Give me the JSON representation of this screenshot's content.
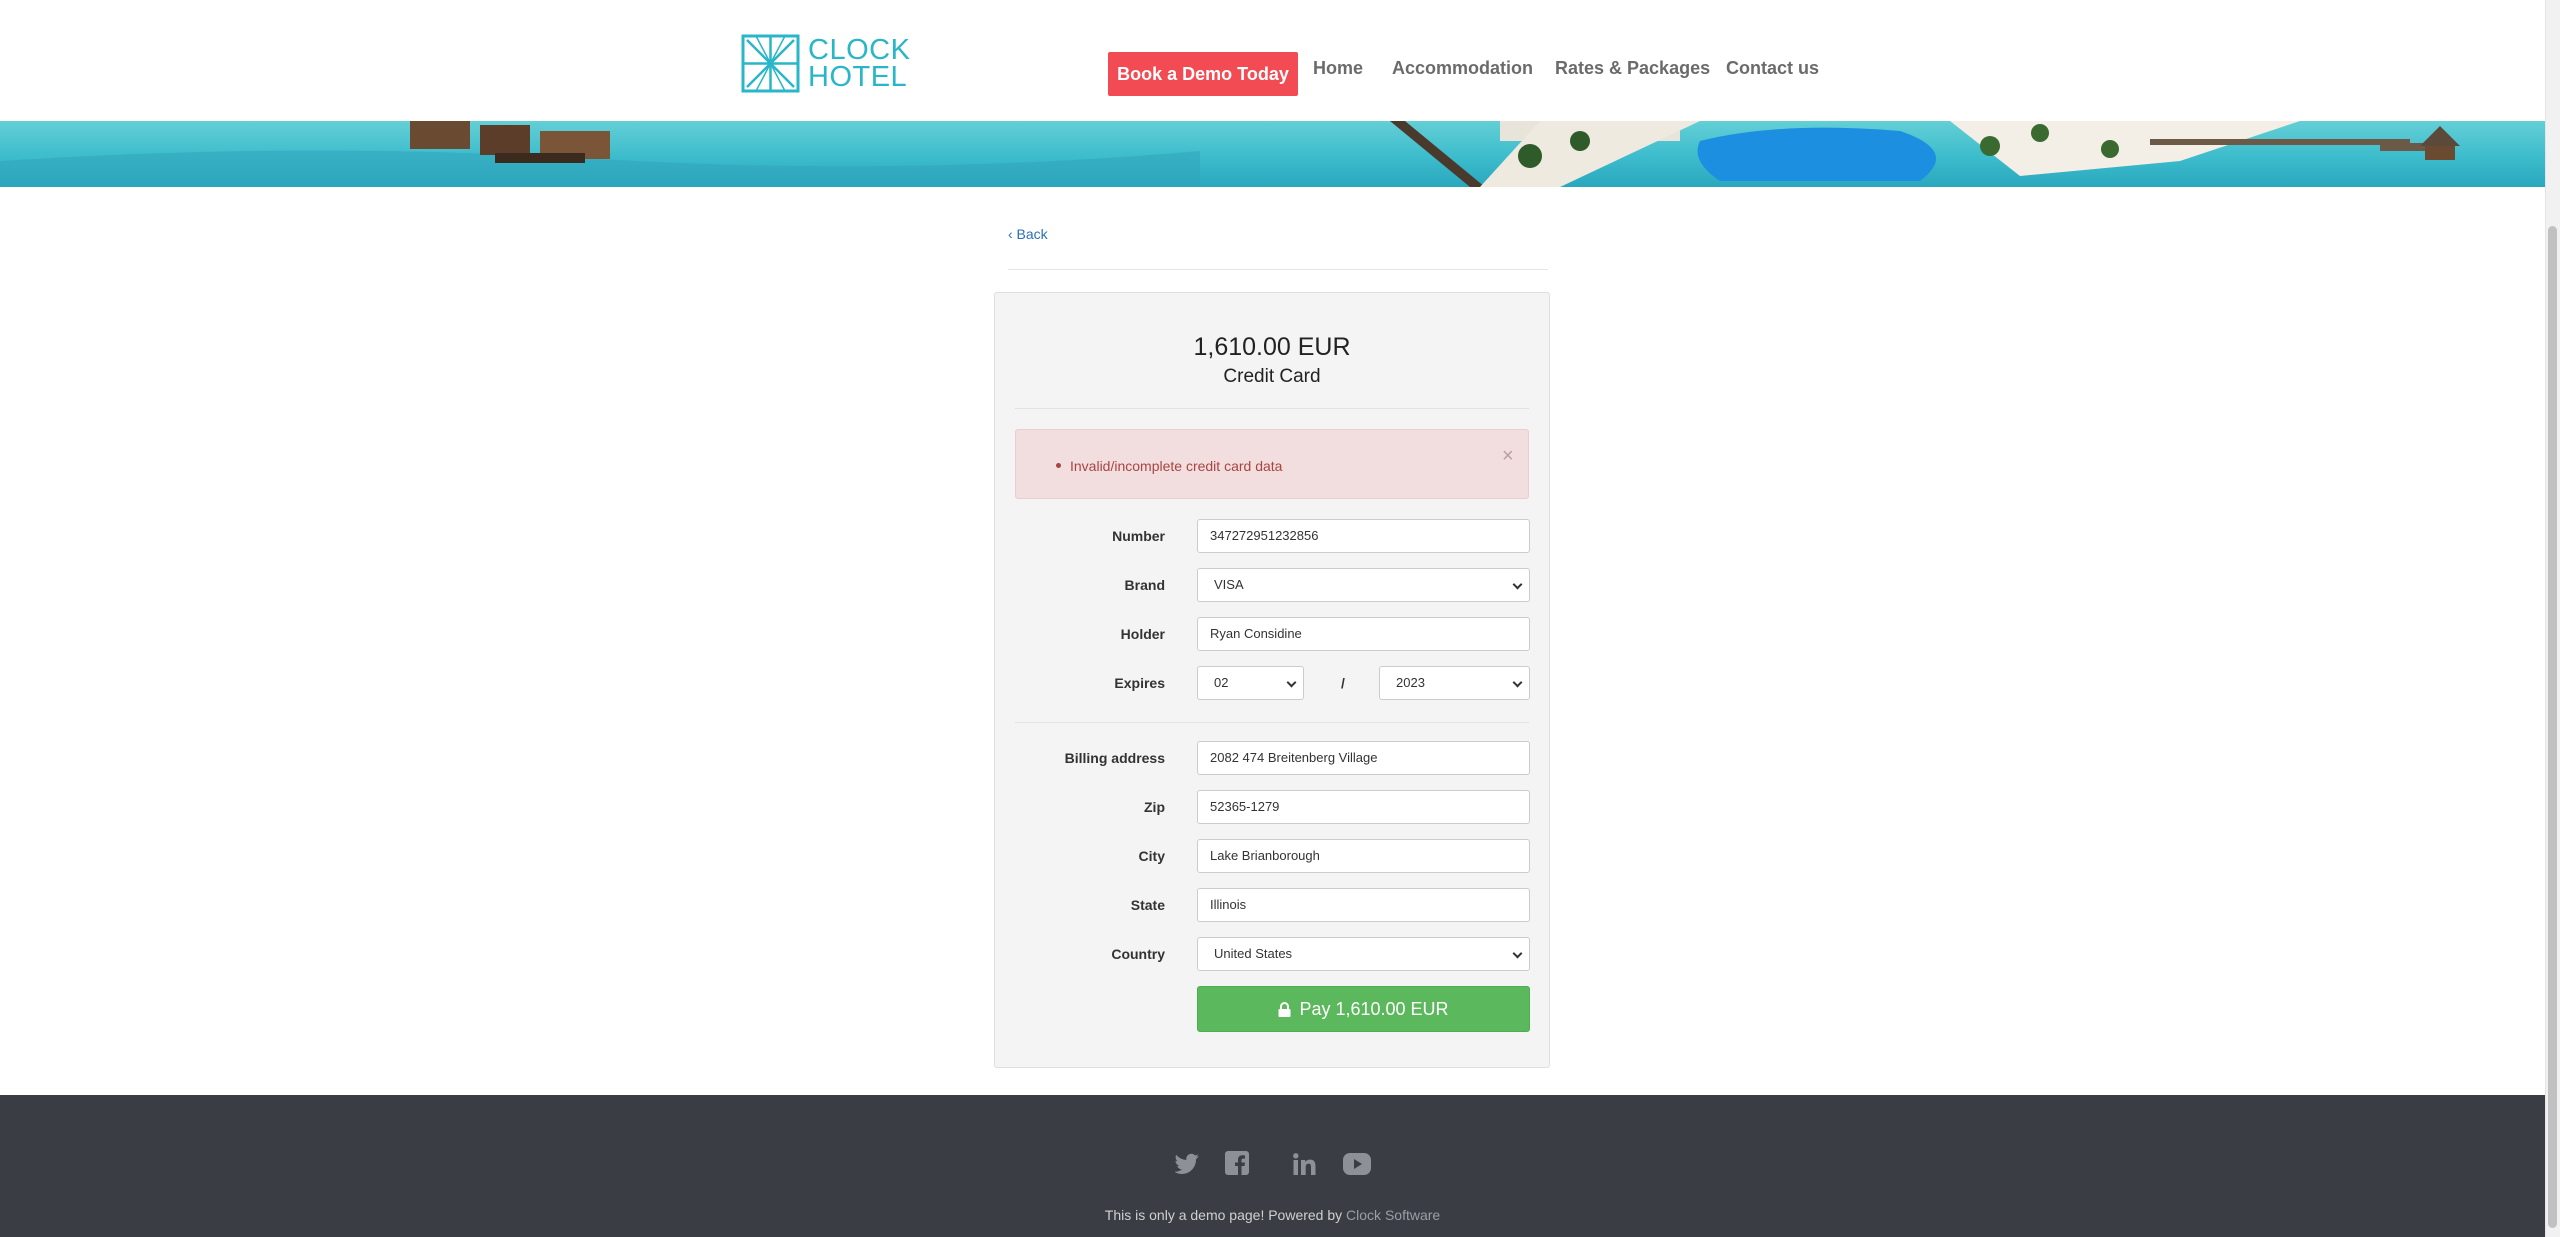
{
  "header": {
    "logo_line1": "CLOCK",
    "logo_line2": "HOTEL",
    "demo_button": "Book a Demo Today",
    "nav": [
      "Home",
      "Accommodation",
      "Rates & Packages",
      "Contact us"
    ]
  },
  "back_link": "‹ Back",
  "payment": {
    "amount": "1,610.00 EUR",
    "method": "Credit Card",
    "error_message": "Invalid/incomplete credit card data",
    "close_symbol": "×"
  },
  "form": {
    "number_label": "Number",
    "number_value": "347272951232856",
    "brand_label": "Brand",
    "brand_value": "VISA",
    "holder_label": "Holder",
    "holder_value": "Ryan Considine",
    "expires_label": "Expires",
    "expires_month": "02",
    "expires_separator": "/",
    "expires_year": "2023",
    "billing_label": "Billing address",
    "billing_value": "2082 474 Breitenberg Village",
    "zip_label": "Zip",
    "zip_value": "52365-1279",
    "city_label": "City",
    "city_value": "Lake Brianborough",
    "state_label": "State",
    "state_value": "Illinois",
    "country_label": "Country",
    "country_value": "United States",
    "pay_button": "Pay 1,610.00 EUR"
  },
  "footer": {
    "social_icons": [
      "twitter-icon",
      "facebook-icon",
      "linkedin-icon",
      "youtube-icon"
    ],
    "text": "This is only a demo page! Powered by",
    "link": "Clock Software"
  },
  "colors": {
    "brand": "#29b6c8",
    "demo_button": "#f24b54",
    "pay_button": "#5cb85c",
    "alert_bg": "#f2dede",
    "alert_text": "#a94442",
    "footer_bg": "#3a3d44"
  }
}
